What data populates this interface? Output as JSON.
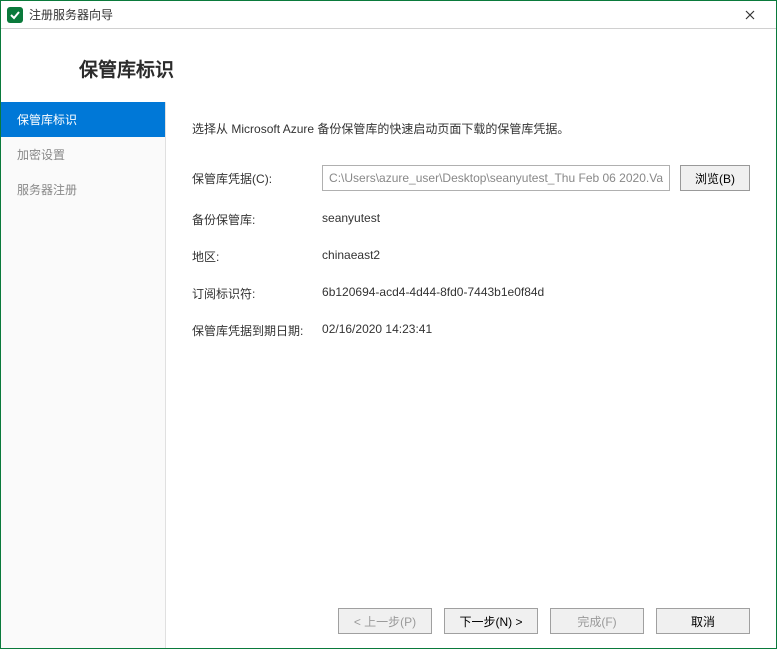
{
  "titlebar": {
    "title": "注册服务器向导"
  },
  "header": {
    "title": "保管库标识"
  },
  "sidebar": {
    "items": [
      {
        "label": "保管库标识",
        "active": true
      },
      {
        "label": "加密设置",
        "active": false
      },
      {
        "label": "服务器注册",
        "active": false
      }
    ]
  },
  "main": {
    "description": "选择从 Microsoft Azure 备份保管库的快速启动页面下载的保管库凭据。",
    "credential_label": "保管库凭据(C):",
    "credential_path": "C:\\Users\\azure_user\\Desktop\\seanyutest_Thu Feb 06 2020.Va",
    "browse": "浏览(B)",
    "rows": [
      {
        "label": "备份保管库:",
        "value": "seanyutest"
      },
      {
        "label": "地区:",
        "value": "chinaeast2"
      },
      {
        "label": "订阅标识符:",
        "value": "6b120694-acd4-4d44-8fd0-7443b1e0f84d"
      },
      {
        "label": "保管库凭据到期日期:",
        "value": "02/16/2020 14:23:41"
      }
    ]
  },
  "footer": {
    "prev": "< 上一步(P)",
    "next": "下一步(N) >",
    "finish": "完成(F)",
    "cancel": "取消"
  }
}
